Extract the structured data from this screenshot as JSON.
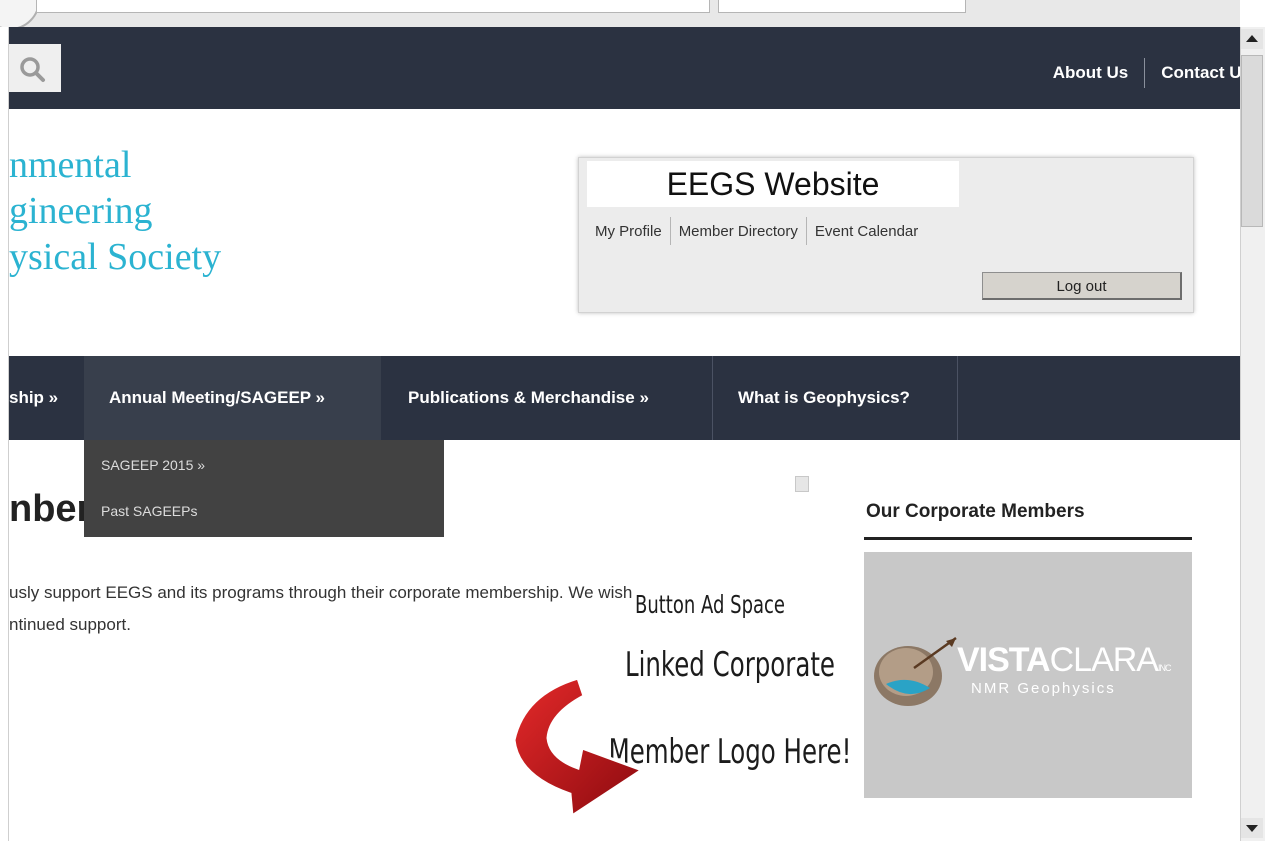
{
  "header": {
    "search_icon": "search-icon",
    "links": [
      "About Us",
      "Contact Us"
    ]
  },
  "logo": {
    "line1": "nmental",
    "line2": "gineering",
    "line3": "ysical Society"
  },
  "login": {
    "title": "EEGS Website",
    "links": [
      "My Profile",
      "Member Directory",
      "Event Calendar"
    ],
    "logout_label": "Log out"
  },
  "nav": {
    "items": [
      "ship »",
      "Annual Meeting/SAGEEP »",
      "Publications & Merchandise »",
      "What is Geophysics?"
    ],
    "dropdown": [
      "SAGEEP 2015 »",
      "Past SAGEEPs"
    ]
  },
  "main": {
    "heading": "nbers",
    "intro_line1": "usly support EEGS and its programs through their corporate membership. We wish",
    "intro_line2": "ntinued support."
  },
  "sidebar": {
    "title": "Our Corporate Members",
    "logo_main_bold": "VISTA",
    "logo_main_light": "CLARA",
    "logo_inc": "INC",
    "logo_sub": "NMR Geophysics"
  },
  "annotation": {
    "small": "Button Ad Space",
    "line1": "Linked Corporate",
    "line2": "Member Logo Here!"
  },
  "colors": {
    "topbar": "#2b3241",
    "logo_teal": "#2bb3d1",
    "arrow_red": "#c0111a"
  }
}
